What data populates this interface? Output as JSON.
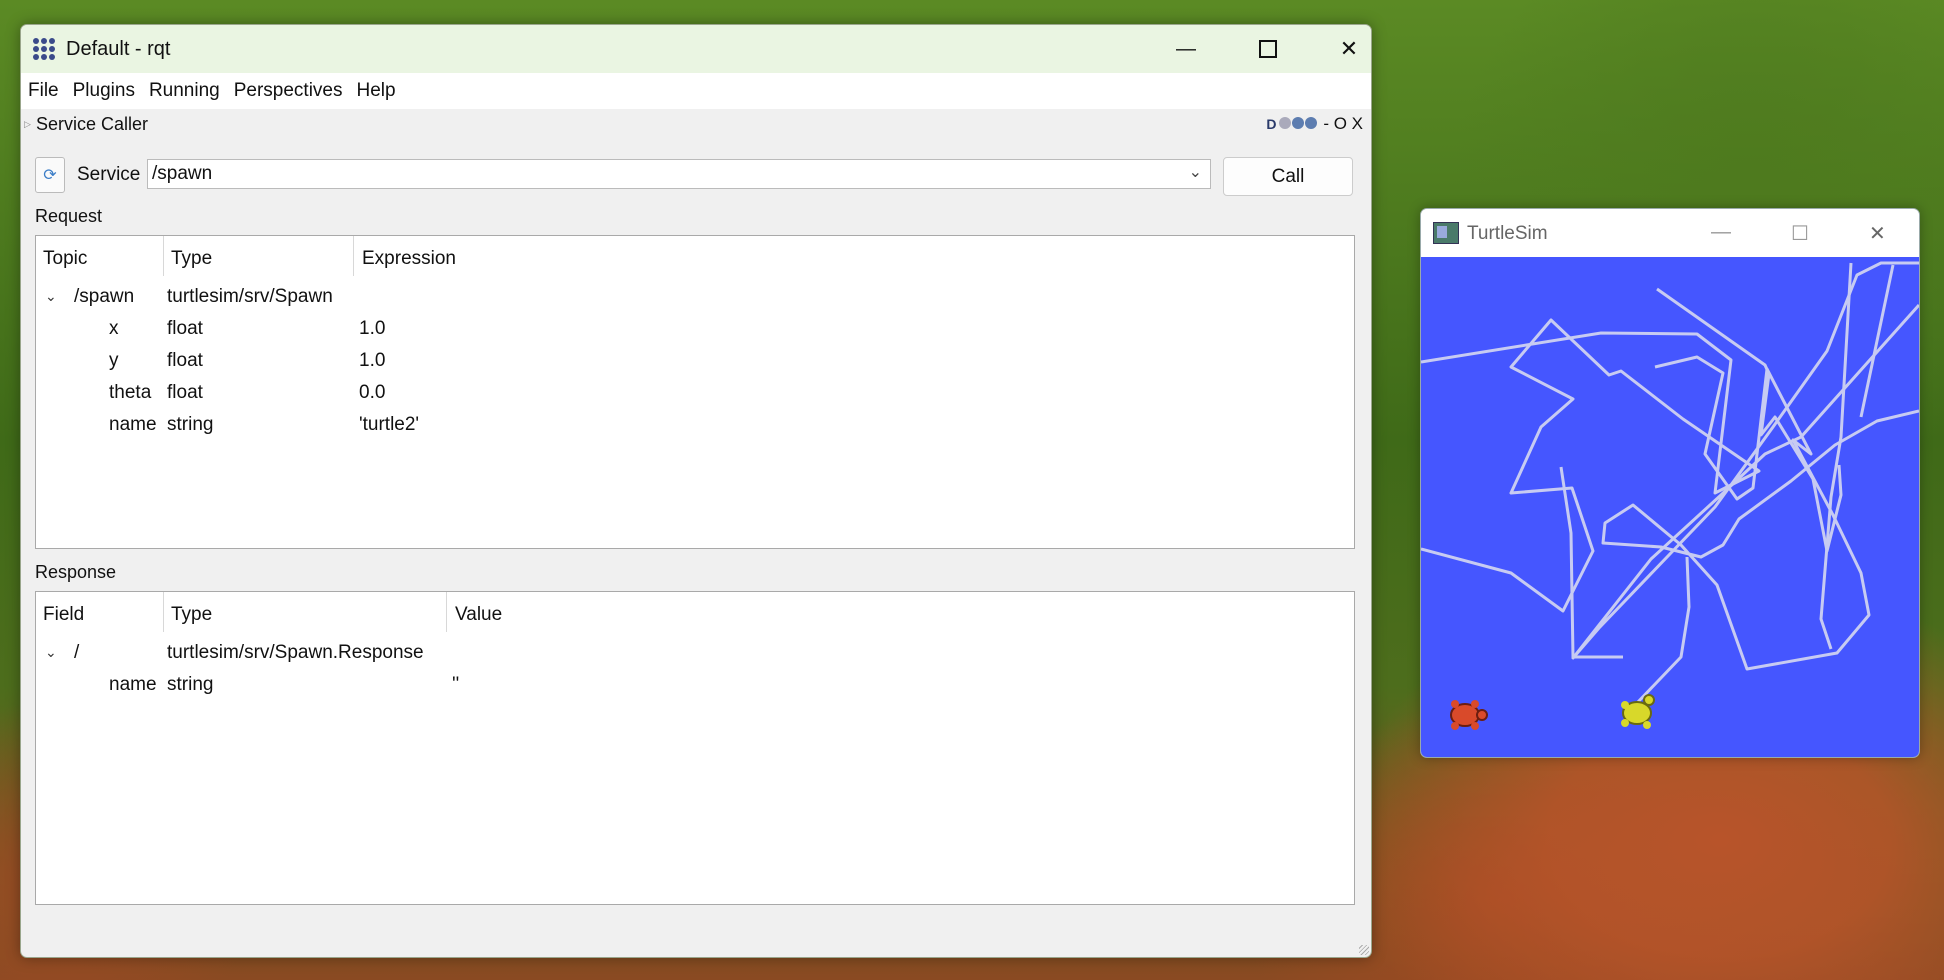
{
  "rqt": {
    "title": "Default - rqt",
    "menu": [
      "File",
      "Plugins",
      "Running",
      "Perspectives",
      "Help"
    ],
    "plugin_title": "Service Caller",
    "plugin_tools_letter": "D",
    "plugin_tools_text": "- O X",
    "service_label": "Service",
    "service_value": "/spawn",
    "call_label": "Call",
    "request_label": "Request",
    "request_headers": [
      "Topic",
      "Type",
      "Expression"
    ],
    "request_root": {
      "topic": "/spawn",
      "type": "turtlesim/srv/Spawn"
    },
    "request_rows": [
      {
        "topic": "x",
        "type": "float",
        "expr": "1.0"
      },
      {
        "topic": "y",
        "type": "float",
        "expr": "1.0"
      },
      {
        "topic": "theta",
        "type": "float",
        "expr": "0.0"
      },
      {
        "topic": "name",
        "type": "string",
        "expr": "'turtle2'"
      }
    ],
    "response_label": "Response",
    "response_headers": [
      "Field",
      "Type",
      "Value"
    ],
    "response_root": {
      "field": "/",
      "type": "turtlesim/srv/Spawn.Response"
    },
    "response_rows": [
      {
        "field": "name",
        "type": "string",
        "value": "''"
      }
    ]
  },
  "turtlesim": {
    "title": "TurtleSim",
    "background_color": "#4556ff",
    "path_color": "#c7cbf2"
  }
}
